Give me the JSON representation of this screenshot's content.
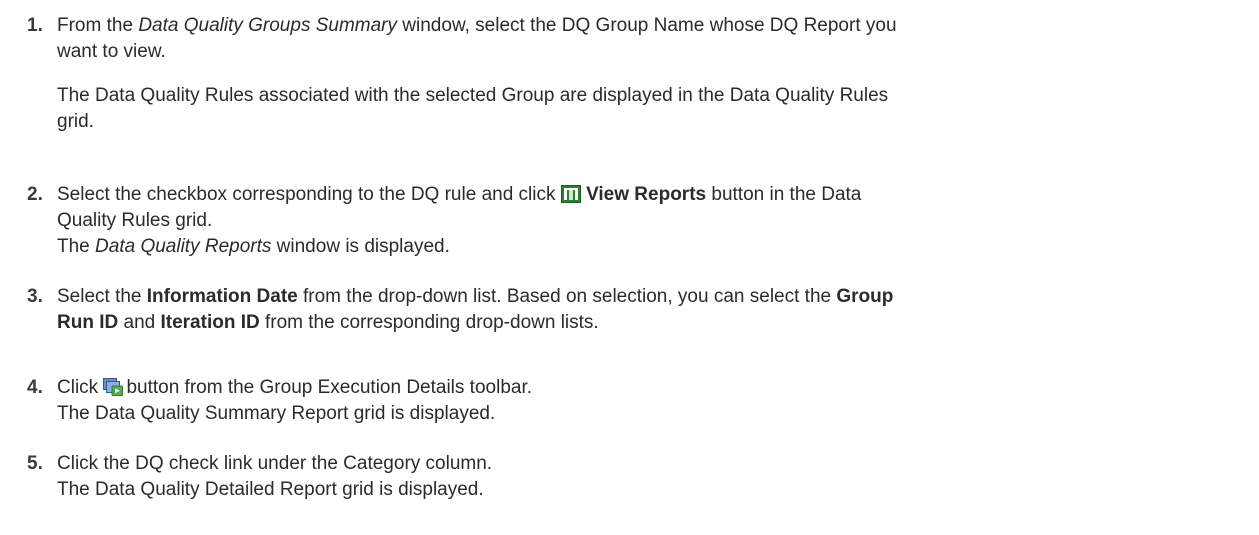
{
  "steps": [
    {
      "number": "1.",
      "line1": {
        "pre": "From the ",
        "em": "Data Quality Groups Summary",
        "post": " window, select the DQ Group Name whose DQ Report you"
      },
      "line2": "want to view.",
      "para2_line1": "The Data Quality Rules associated with the selected Group are displayed in the Data Quality Rules",
      "para2_line2": "grid."
    },
    {
      "number": "2.",
      "line1": {
        "pre": "Select the checkbox corresponding to the DQ rule and click ",
        "icon": "view-reports-icon",
        "strong": "View Reports",
        "post": " button in the Data"
      },
      "line2": "Quality Rules grid.",
      "line3": {
        "pre": "The ",
        "em": "Data Quality Reports",
        "post": " window is displayed."
      }
    },
    {
      "number": "3.",
      "line1": {
        "pre": "Select the ",
        "strong1": "Information Date",
        "mid": " from the drop-down list. Based on selection, you can select the ",
        "strong2": "Group"
      },
      "line2": {
        "strong1": "Run ID",
        "mid": " and ",
        "strong2": "Iteration ID",
        "post": " from the corresponding drop-down lists."
      }
    },
    {
      "number": "4.",
      "line1": {
        "pre": "Click ",
        "icon": "execute-icon",
        "post": "button from the Group Execution Details toolbar."
      },
      "line2": "The Data Quality Summary Report grid is displayed."
    },
    {
      "number": "5.",
      "line1": "Click the DQ check link under the Category column.",
      "line2": "The Data Quality Detailed Report grid is displayed."
    }
  ],
  "colors": {
    "text": "#2b2b2b",
    "icon_green": "#3f8f3f",
    "icon_blue": "#3a6fb0"
  }
}
